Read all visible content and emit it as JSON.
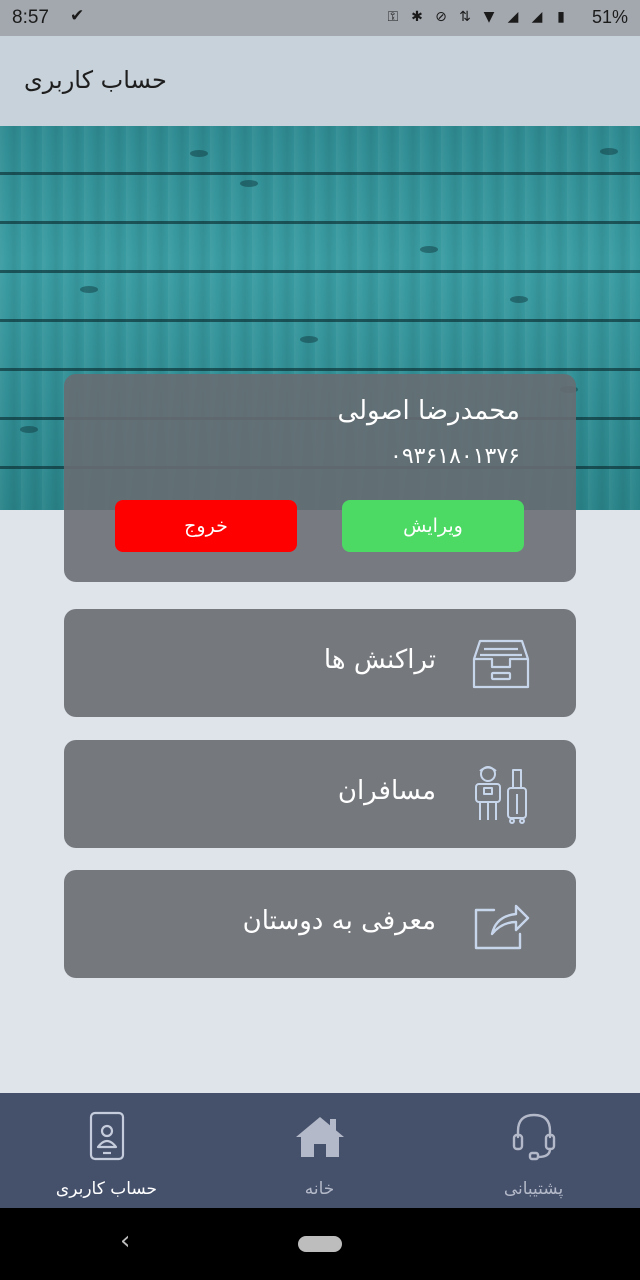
{
  "status_bar": {
    "time": "8:57",
    "battery": "51%"
  },
  "header": {
    "title": "حساب کاربری"
  },
  "profile": {
    "name": "محمدرضا اصولی",
    "phone": "۰۹۳۶۱۸۰۱۳۷۶",
    "edit_label": "ویرایش",
    "exit_label": "خروج",
    "colors": {
      "edit": "#4cd964",
      "exit": "#ff0000"
    }
  },
  "menu": [
    {
      "label": "تراکنش ها",
      "icon": "inbox-tray-icon"
    },
    {
      "label": "مسافران",
      "icon": "travelers-luggage-icon"
    },
    {
      "label": "معرفی به دوستان",
      "icon": "share-icon"
    }
  ],
  "bottom_nav": [
    {
      "label": "حساب کاربری",
      "icon": "id-card-icon",
      "active": true
    },
    {
      "label": "خانه",
      "icon": "home-icon",
      "active": false
    },
    {
      "label": "پشتیبانی",
      "icon": "headset-icon",
      "active": false
    }
  ],
  "system_nav": {
    "back_icon": "chevron-left-icon",
    "home_icon": "home-pill-icon"
  }
}
